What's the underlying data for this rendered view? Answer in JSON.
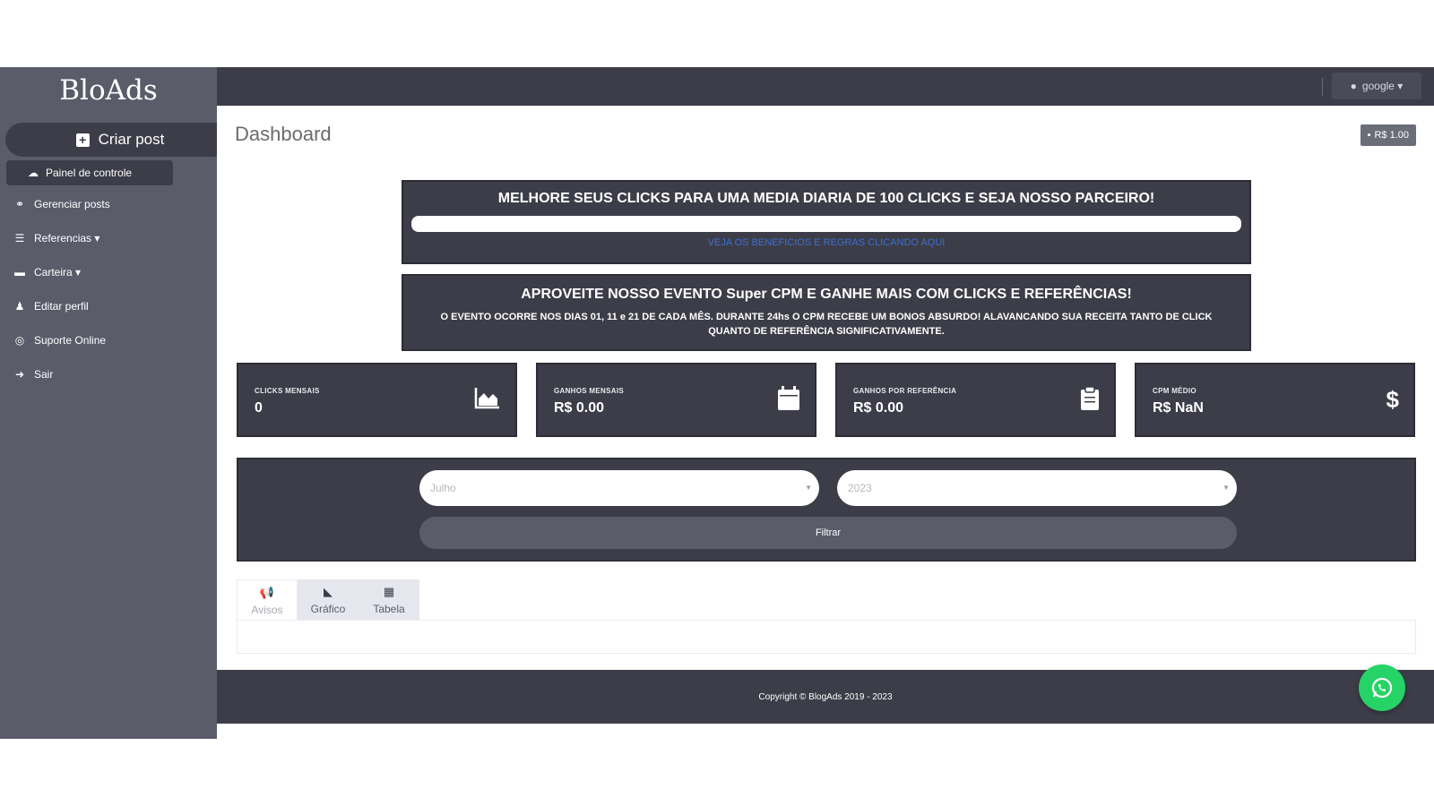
{
  "brand": {
    "logo": "BloAds"
  },
  "sidebar": {
    "create_post": "Criar post",
    "items": [
      {
        "label": "Painel de controle",
        "icon": "dashboard-icon",
        "glyph": "☁"
      },
      {
        "label": "Gerenciar posts",
        "icon": "link-icon",
        "glyph": "🔗"
      },
      {
        "label": "Referencias ▾",
        "icon": "users-icon",
        "glyph": "👥"
      },
      {
        "label": "Carteira ▾",
        "icon": "wallet-icon",
        "glyph": "▬"
      },
      {
        "label": "Editar perfil",
        "icon": "user-edit-icon",
        "glyph": "👤"
      },
      {
        "label": "Suporte Online",
        "icon": "whatsapp-icon",
        "glyph": "◎"
      },
      {
        "label": "Sair",
        "icon": "logout-icon",
        "glyph": "➜"
      }
    ]
  },
  "topbar": {
    "user": "google ▾"
  },
  "header": {
    "title": "Dashboard",
    "balance": "R$ 1.00"
  },
  "banners": {
    "first": {
      "title": "MELHORE SEUS CLICKS PARA UMA MEDIA DIARIA DE 100 CLICKS E SEJA NOSSO PARCEIRO!",
      "link": "VEJA OS BENEFICIOS E REGRAS CLICANDO AQUI"
    },
    "second": {
      "title": "APROVEITE NOSSO EVENTO Super CPM E GANHE MAIS COM CLICKS E REFERÊNCIAS!",
      "text": "O EVENTO OCORRE NOS DIAS 01, 11 e 21 DE CADA MÊS. DURANTE 24hs O CPM RECEBE UM BONOS ABSURDO! ALAVANCANDO SUA RECEITA TANTO DE CLICK QUANTO DE REFERÊNCIA SIGNIFICATIVAMENTE."
    }
  },
  "cards": [
    {
      "label": "CLICKS MENSAIS",
      "value": "0",
      "icon": "area-chart-icon"
    },
    {
      "label": "GANHOS MENSAIS",
      "value": "R$ 0.00",
      "icon": "calendar-icon"
    },
    {
      "label": "GANHOS POR REFERÊNCIA",
      "value": "R$ 0.00",
      "icon": "clipboard-icon"
    },
    {
      "label": "CPM MÉDIO",
      "value": "R$ NaN",
      "icon": "dollar-icon"
    }
  ],
  "filter": {
    "month": "Julho",
    "year": "2023",
    "button": "Filtrar"
  },
  "tabs": [
    {
      "label": "Avisos",
      "icon": "megaphone-icon"
    },
    {
      "label": "Gráfico",
      "icon": "chart-icon"
    },
    {
      "label": "Tabela",
      "icon": "table-icon"
    }
  ],
  "footer": {
    "copyright": "Copyright © BlogAds 2019 - 2023"
  },
  "colors": {
    "sidebar": "#5a5c6a",
    "dark": "#3c3d48",
    "link": "#3b6fd6",
    "whatsapp": "#25d366"
  }
}
